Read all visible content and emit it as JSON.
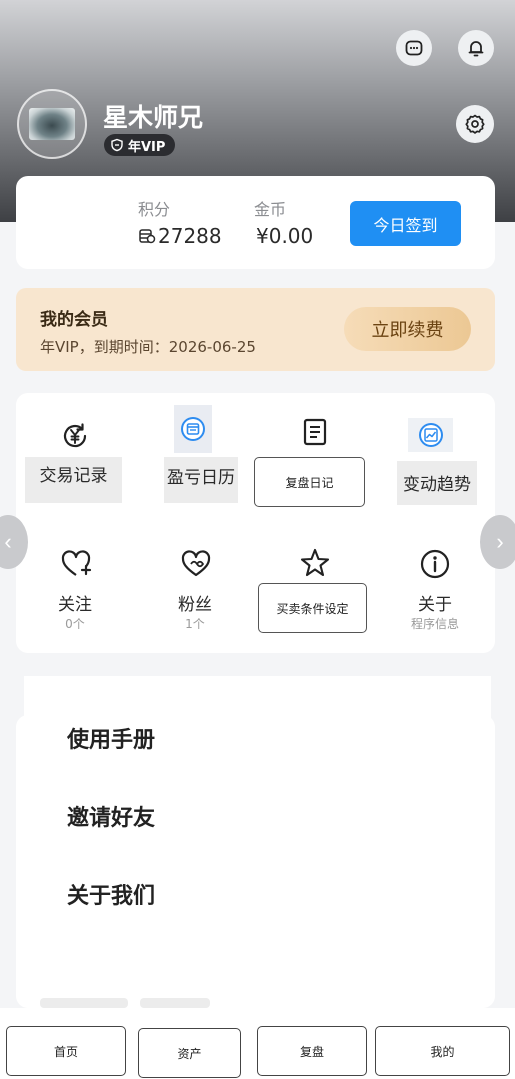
{
  "header": {
    "username": "星木师兄",
    "vip_badge": "年VIP",
    "icons": [
      "message-icon",
      "bell-icon",
      "settings-icon"
    ]
  },
  "stats": {
    "points_label": "积分",
    "points_value": "27288",
    "coins_label": "金币",
    "coins_value": "¥0.00",
    "checkin_label": "今日签到"
  },
  "membership": {
    "title": "我的会员",
    "subtitle": "年VIP，到期时间：2026-06-25",
    "renew_label": "立即续费"
  },
  "grid": {
    "row1": [
      {
        "label": "交易记录",
        "icon": "yuan-refresh-icon"
      },
      {
        "label": "盈亏日历",
        "icon": "calendar-icon"
      },
      {
        "label": "复盘日记",
        "icon": "document-icon"
      },
      {
        "label": "变动趋势",
        "icon": "trend-chart-icon"
      }
    ],
    "row2": [
      {
        "label": "关注",
        "sub": "0个",
        "icon": "heart-plus-icon"
      },
      {
        "label": "粉丝",
        "sub": "1个",
        "icon": "heart-icon"
      },
      {
        "label": "买卖条件设定",
        "icon": "star-icon"
      },
      {
        "label": "关于",
        "sub": "程序信息",
        "icon": "info-icon"
      }
    ]
  },
  "menu": {
    "items": [
      "使用手册",
      "邀请好友",
      "关于我们"
    ]
  },
  "tabbar": {
    "items": [
      "首页",
      "资产",
      "复盘",
      "我的"
    ]
  },
  "colors": {
    "accent": "#1f8ff3",
    "member_bg": "#f8e6cf",
    "renew_text": "#6b4312"
  }
}
